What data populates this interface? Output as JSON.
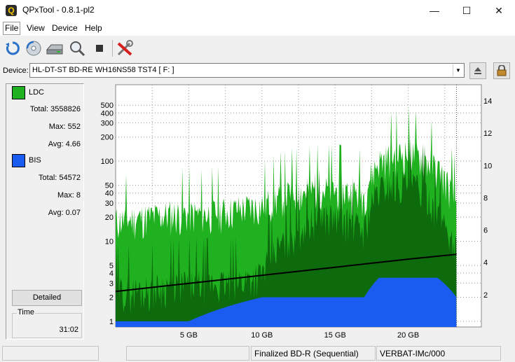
{
  "window": {
    "title": "QPxTool - 0.8.1-pl2",
    "app_icon_letter": "Q"
  },
  "menu": [
    "File",
    "View",
    "Device",
    "Help"
  ],
  "toolbar": {
    "icons": [
      "refresh-icon",
      "disc-scan-icon",
      "drive-icon",
      "magnifier-icon",
      "stop-icon",
      "tools-icon"
    ]
  },
  "device": {
    "label": "Device:",
    "value": "HL-DT-ST BD-RE  WH16NS58  TST4 [ F: ]"
  },
  "stats": {
    "ldc": {
      "name": "LDC",
      "color": "#1fb11f",
      "total_label": "Total:",
      "total": "3558826",
      "max_label": "Max:",
      "max": "552",
      "avg_label": "Avg:",
      "avg": "4.66"
    },
    "bis": {
      "name": "BIS",
      "color": "#1a5cf0",
      "total_label": "Total:",
      "total": "54572",
      "max_label": "Max:",
      "max": "8",
      "avg_label": "Avg:",
      "avg": "0.07"
    },
    "detailed_button": "Detailed",
    "time_label": "Time",
    "time_value": "31:02"
  },
  "chart_data": {
    "type": "area",
    "y_left_scale": "log",
    "y_left_ticks": [
      "1",
      "2",
      "3",
      "4",
      "5",
      "10",
      "20",
      "30",
      "40",
      "50",
      "100",
      "200",
      "300",
      "400",
      "500"
    ],
    "y_left_range": [
      0.85,
      900
    ],
    "y_right_ticks": [
      "2",
      "4",
      "6",
      "8",
      "10",
      "12",
      "14"
    ],
    "y_right_range": [
      0,
      15
    ],
    "x_ticks": [
      "5 GB",
      "10 GB",
      "15 GB",
      "20 GB"
    ],
    "x_range_gb": [
      0,
      25
    ],
    "x_end_gb": 23.3,
    "grid": true,
    "series": [
      {
        "name": "LDC",
        "color": "#1fb11f",
        "axis": "left",
        "x": [
          0,
          2,
          4,
          6,
          8,
          10,
          12,
          14,
          16,
          17,
          18,
          19,
          20,
          21,
          22,
          23,
          23.3
        ],
        "values": [
          18,
          20,
          22,
          22,
          25,
          28,
          40,
          45,
          42,
          38,
          100,
          120,
          130,
          110,
          80,
          40,
          30
        ]
      },
      {
        "name": "LDC-avg",
        "color": "#0d6a0d",
        "axis": "left",
        "x": [
          0,
          2,
          4,
          6,
          8,
          10,
          12,
          14,
          16,
          17,
          18,
          19,
          20,
          21,
          22,
          23,
          23.3
        ],
        "values": [
          2.5,
          2.5,
          3,
          3,
          3,
          4,
          12,
          22,
          18,
          14,
          45,
          55,
          55,
          45,
          25,
          10,
          8
        ]
      },
      {
        "name": "BIS",
        "color": "#1a5cf0",
        "axis": "left",
        "x": [
          0,
          5,
          10,
          15,
          17,
          18,
          20,
          22,
          23.3
        ],
        "values": [
          1,
          1,
          2,
          2,
          2,
          3.5,
          3.5,
          3.5,
          2
        ]
      },
      {
        "name": "Speed",
        "color": "#000000",
        "axis": "right",
        "x": [
          0,
          5,
          10,
          15,
          20,
          23.3
        ],
        "values": [
          2.2,
          2.7,
          3.2,
          3.7,
          4.2,
          4.5
        ]
      }
    ]
  },
  "statusbar": {
    "cell1": "",
    "cell2": "",
    "disc_type": "Finalized BD-R (Sequential)",
    "media_id": "VERBAT-IMc/000"
  }
}
